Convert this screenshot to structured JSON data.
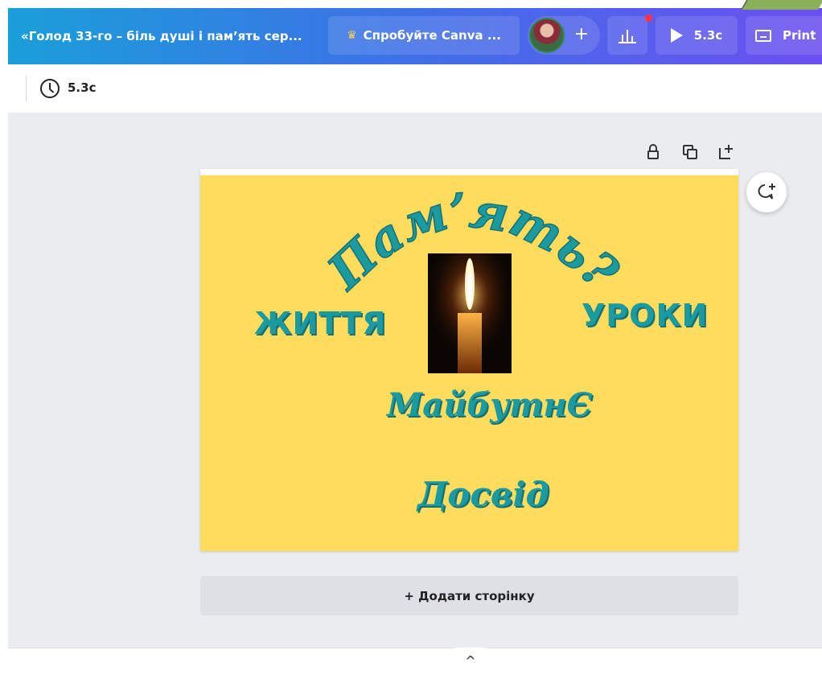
{
  "topbar": {
    "doc_title": "«Голод 33-го – біль душі і пам’ять сер...",
    "try_canva_label": "Спробуйте Canva ...",
    "add_label": "+",
    "play_label": "5.3с",
    "print_label": "Print",
    "gradient_start": "#1a9fd9",
    "gradient_end": "#6b4ff0"
  },
  "subbar": {
    "duration": "5.3с"
  },
  "design": {
    "background_color": "#ffdc5c",
    "text_color": "#1b9aa0",
    "arc_text": "Пам’ять?",
    "left_word": "ЖИТТЯ",
    "right_word": "УРОКИ",
    "middle_word": "МайбутнЄ",
    "bottom_word": "Досвід"
  },
  "add_page_label": "+ Додати сторінку",
  "collapse_label": "^"
}
